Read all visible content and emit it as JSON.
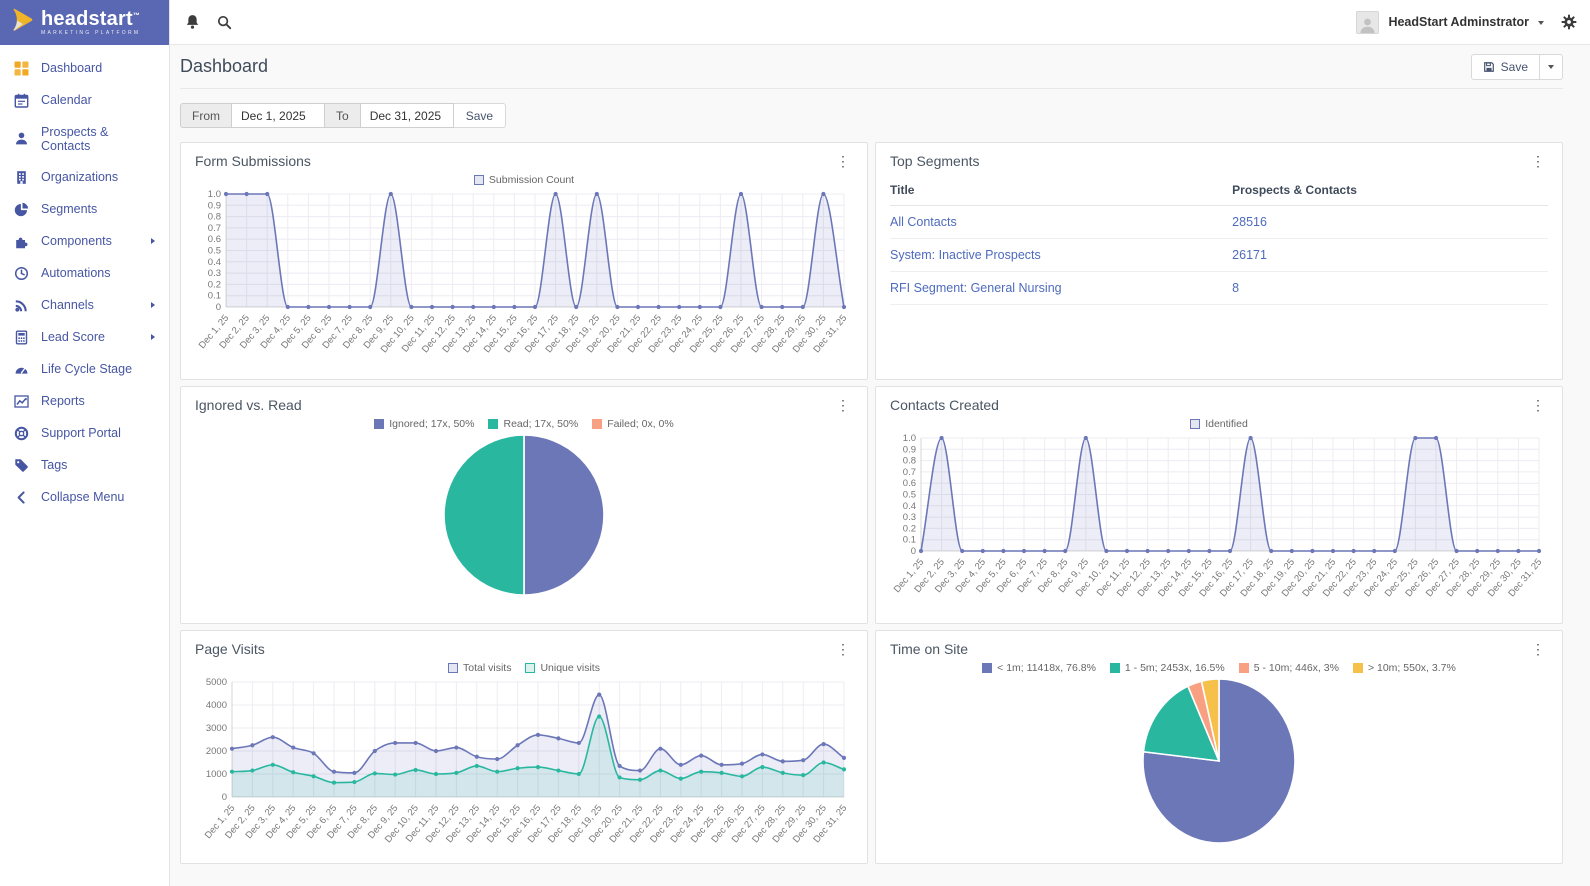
{
  "brand": {
    "name": "headstart",
    "tm": "™",
    "tagline": "MARKETING PLATFORM"
  },
  "topbar": {
    "user_name": "HeadStart Adminstrator"
  },
  "page": {
    "title": "Dashboard",
    "save_label": "Save"
  },
  "filter": {
    "from_label": "From",
    "from_value": "Dec 1, 2025",
    "to_label": "To",
    "to_value": "Dec 31, 2025",
    "save_label": "Save"
  },
  "sidebar": {
    "items": [
      {
        "label": "Dashboard",
        "icon": "dashboard",
        "active": true,
        "submenu": false
      },
      {
        "label": "Calendar",
        "icon": "calendar",
        "active": false,
        "submenu": false
      },
      {
        "label": "Prospects & Contacts",
        "icon": "user",
        "active": false,
        "submenu": false
      },
      {
        "label": "Organizations",
        "icon": "building",
        "active": false,
        "submenu": false
      },
      {
        "label": "Segments",
        "icon": "pie",
        "active": false,
        "submenu": false
      },
      {
        "label": "Components",
        "icon": "components",
        "active": false,
        "submenu": true
      },
      {
        "label": "Automations",
        "icon": "clock",
        "active": false,
        "submenu": false
      },
      {
        "label": "Channels",
        "icon": "rss",
        "active": false,
        "submenu": true
      },
      {
        "label": "Lead Score",
        "icon": "calculator",
        "active": false,
        "submenu": true
      },
      {
        "label": "Life Cycle Stage",
        "icon": "gauge",
        "active": false,
        "submenu": false
      },
      {
        "label": "Reports",
        "icon": "chart",
        "active": false,
        "submenu": false
      },
      {
        "label": "Support Portal",
        "icon": "lifering",
        "active": false,
        "submenu": false
      },
      {
        "label": "Tags",
        "icon": "tag",
        "active": false,
        "submenu": false
      },
      {
        "label": "Collapse Menu",
        "icon": "collapse",
        "active": false,
        "submenu": false
      }
    ]
  },
  "colors": {
    "sidebar_header": "#5a67b2",
    "accent_purple": "#6c77b8",
    "teal": "#2ab7a0",
    "salmon": "#f9a083",
    "amber": "#f6c14b",
    "link": "#4e6bbd",
    "active_icon": "#f2a922"
  },
  "chart_data": [
    {
      "id": "form_submissions",
      "type": "line",
      "title": "Form Submissions",
      "legend_position": "top",
      "grid": true,
      "categories": [
        "Dec 1, 25",
        "Dec 2, 25",
        "Dec 3, 25",
        "Dec 4, 25",
        "Dec 5, 25",
        "Dec 6, 25",
        "Dec 7, 25",
        "Dec 8, 25",
        "Dec 9, 25",
        "Dec 10, 25",
        "Dec 11, 25",
        "Dec 12, 25",
        "Dec 13, 25",
        "Dec 14, 25",
        "Dec 15, 25",
        "Dec 16, 25",
        "Dec 17, 25",
        "Dec 18, 25",
        "Dec 19, 25",
        "Dec 20, 25",
        "Dec 21, 25",
        "Dec 22, 25",
        "Dec 23, 25",
        "Dec 24, 25",
        "Dec 25, 25",
        "Dec 26, 25",
        "Dec 27, 25",
        "Dec 28, 25",
        "Dec 29, 25",
        "Dec 30, 25",
        "Dec 31, 25"
      ],
      "series": [
        {
          "name": "Submission Count",
          "color": "#6c77b8",
          "values": [
            1,
            1,
            1,
            0,
            0,
            0,
            0,
            0,
            1,
            0,
            0,
            0,
            0,
            0,
            0,
            0,
            1,
            0,
            1,
            0,
            0,
            0,
            0,
            0,
            0,
            1,
            0,
            0,
            0,
            1,
            0
          ]
        }
      ],
      "ylim": [
        0,
        1
      ],
      "yticks": [
        "0",
        "0.1",
        "0.2",
        "0.3",
        "0.4",
        "0.5",
        "0.6",
        "0.7",
        "0.8",
        "0.9",
        "1.0"
      ]
    },
    {
      "id": "top_segments",
      "type": "table",
      "title": "Top Segments",
      "columns": [
        "Title",
        "Prospects & Contacts"
      ],
      "rows": [
        [
          "All Contacts",
          "28516"
        ],
        [
          "System: Inactive Prospects",
          "26171"
        ],
        [
          "RFI Segment: General Nursing",
          "8"
        ]
      ]
    },
    {
      "id": "ignored_vs_read",
      "type": "pie",
      "title": "Ignored vs. Read",
      "legend_position": "top",
      "slices": [
        {
          "label": "Ignored; 17x, 50%",
          "value": 17,
          "pct": 50,
          "color": "#6c77b8"
        },
        {
          "label": "Read; 17x, 50%",
          "value": 17,
          "pct": 50,
          "color": "#2ab7a0"
        },
        {
          "label": "Failed; 0x, 0%",
          "value": 0,
          "pct": 0,
          "color": "#f9a083"
        }
      ]
    },
    {
      "id": "contacts_created",
      "type": "line",
      "title": "Contacts Created",
      "legend_position": "top",
      "grid": true,
      "categories": [
        "Dec 1, 25",
        "Dec 2, 25",
        "Dec 3, 25",
        "Dec 4, 25",
        "Dec 5, 25",
        "Dec 6, 25",
        "Dec 7, 25",
        "Dec 8, 25",
        "Dec 9, 25",
        "Dec 10, 25",
        "Dec 11, 25",
        "Dec 12, 25",
        "Dec 13, 25",
        "Dec 14, 25",
        "Dec 15, 25",
        "Dec 16, 25",
        "Dec 17, 25",
        "Dec 18, 25",
        "Dec 19, 25",
        "Dec 20, 25",
        "Dec 21, 25",
        "Dec 22, 25",
        "Dec 23, 25",
        "Dec 24, 25",
        "Dec 25, 25",
        "Dec 26, 25",
        "Dec 27, 25",
        "Dec 28, 25",
        "Dec 29, 25",
        "Dec 30, 25",
        "Dec 31, 25"
      ],
      "series": [
        {
          "name": "Identified",
          "color": "#6c77b8",
          "values": [
            0,
            1,
            0,
            0,
            0,
            0,
            0,
            0,
            1,
            0,
            0,
            0,
            0,
            0,
            0,
            0,
            1,
            0,
            0,
            0,
            0,
            0,
            0,
            0,
            1,
            1,
            0,
            0,
            0,
            0,
            0
          ]
        }
      ],
      "ylim": [
        0,
        1
      ],
      "yticks": [
        "0",
        "0.1",
        "0.2",
        "0.3",
        "0.4",
        "0.5",
        "0.6",
        "0.7",
        "0.8",
        "0.9",
        "1.0"
      ]
    },
    {
      "id": "page_visits",
      "type": "line",
      "title": "Page Visits",
      "legend_position": "top",
      "grid": true,
      "categories": [
        "Dec 1, 25",
        "Dec 2, 25",
        "Dec 3, 25",
        "Dec 4, 25",
        "Dec 5, 25",
        "Dec 6, 25",
        "Dec 7, 25",
        "Dec 8, 25",
        "Dec 9, 25",
        "Dec 10, 25",
        "Dec 11, 25",
        "Dec 12, 25",
        "Dec 13, 25",
        "Dec 14, 25",
        "Dec 15, 25",
        "Dec 16, 25",
        "Dec 17, 25",
        "Dec 18, 25",
        "Dec 19, 25",
        "Dec 20, 25",
        "Dec 21, 25",
        "Dec 22, 25",
        "Dec 23, 25",
        "Dec 24, 25",
        "Dec 25, 25",
        "Dec 26, 25",
        "Dec 27, 25",
        "Dec 28, 25",
        "Dec 29, 25",
        "Dec 30, 25",
        "Dec 31, 25"
      ],
      "series": [
        {
          "name": "Total visits",
          "color": "#6c77b8",
          "values": [
            2100,
            2250,
            2600,
            2150,
            1900,
            1100,
            1050,
            2000,
            2350,
            2350,
            2000,
            2150,
            1750,
            1650,
            2250,
            2700,
            2550,
            2350,
            4450,
            1350,
            1150,
            2100,
            1400,
            1800,
            1400,
            1450,
            1850,
            1550,
            1600,
            2300,
            1700
          ]
        },
        {
          "name": "Unique visits",
          "color": "#2ab7a0",
          "values": [
            1100,
            1150,
            1400,
            1075,
            900,
            625,
            650,
            1025,
            975,
            1175,
            1000,
            1050,
            1350,
            1100,
            1250,
            1300,
            1150,
            1000,
            3500,
            850,
            750,
            1150,
            800,
            1100,
            1050,
            900,
            1300,
            1050,
            950,
            1500,
            1200
          ]
        }
      ],
      "ylim": [
        0,
        5000
      ],
      "yticks": [
        "0",
        "1000",
        "2000",
        "3000",
        "4000",
        "5000"
      ]
    },
    {
      "id": "time_on_site",
      "type": "pie",
      "title": "Time on Site",
      "legend_position": "top",
      "slices": [
        {
          "label": "< 1m; 11418x, 76.8%",
          "value": 11418,
          "pct": 76.8,
          "color": "#6c77b8"
        },
        {
          "label": "1 - 5m; 2453x, 16.5%",
          "value": 2453,
          "pct": 16.5,
          "color": "#2ab7a0"
        },
        {
          "label": "5 - 10m; 446x, 3%",
          "value": 446,
          "pct": 3,
          "color": "#f9a083"
        },
        {
          "label": "> 10m; 550x, 3.7%",
          "value": 550,
          "pct": 3.7,
          "color": "#f6c14b"
        }
      ]
    }
  ]
}
